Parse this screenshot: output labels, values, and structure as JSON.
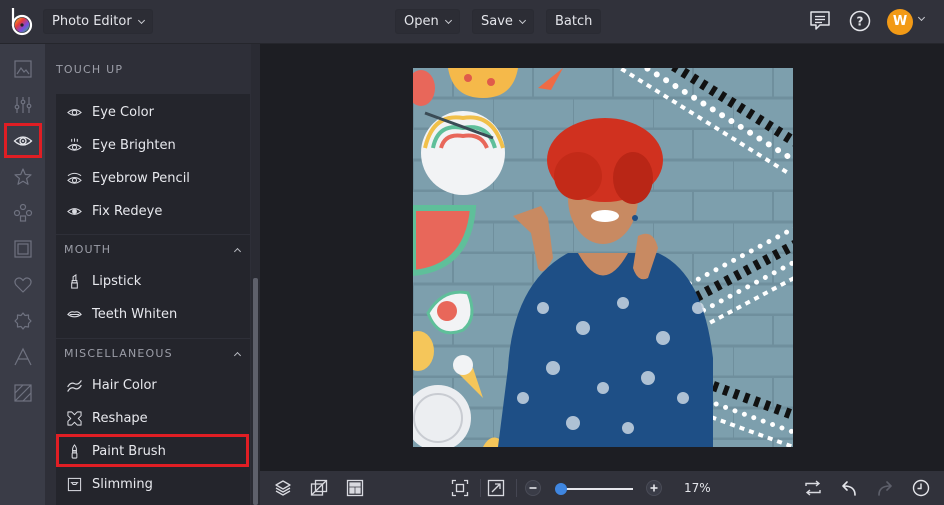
{
  "header": {
    "app_menu_label": "Photo Editor",
    "open_label": "Open",
    "save_label": "Save",
    "batch_label": "Batch",
    "icons": [
      "chat-icon",
      "help-icon"
    ],
    "avatar_initial": "W",
    "avatar_color": "#f29a16"
  },
  "rail": {
    "items": [
      {
        "name": "image-icon"
      },
      {
        "name": "adjust-sliders-icon"
      },
      {
        "name": "eye-icon",
        "active": true
      },
      {
        "name": "star-icon"
      },
      {
        "name": "graphics-icon"
      },
      {
        "name": "frame-icon"
      },
      {
        "name": "heart-icon"
      },
      {
        "name": "badge-icon"
      },
      {
        "name": "text-icon"
      },
      {
        "name": "texture-icon"
      }
    ]
  },
  "panel": {
    "section_title": "TOUCH UP",
    "eyes_items": [
      {
        "label": "Eye Color",
        "icon": "eye-icon"
      },
      {
        "label": "Eye Brighten",
        "icon": "eye-brighten-icon"
      },
      {
        "label": "Eyebrow Pencil",
        "icon": "eyebrow-icon"
      },
      {
        "label": "Fix Redeye",
        "icon": "redeye-icon"
      }
    ],
    "groups": [
      {
        "title": "MOUTH",
        "items": [
          {
            "label": "Lipstick",
            "icon": "lipstick-icon"
          },
          {
            "label": "Teeth Whiten",
            "icon": "lips-icon"
          }
        ]
      },
      {
        "title": "MISCELLANEOUS",
        "items": [
          {
            "label": "Hair Color",
            "icon": "hair-icon"
          },
          {
            "label": "Reshape",
            "icon": "reshape-icon"
          },
          {
            "label": "Paint Brush",
            "icon": "paint-brush-icon",
            "highlighted": true
          },
          {
            "label": "Slimming",
            "icon": "slimming-icon"
          }
        ]
      }
    ],
    "highlight_color": "#e01e24"
  },
  "canvas": {
    "image_alt": "Woman with red curly hair in blue floral dress against blue brick wall with food stickers"
  },
  "footer": {
    "zoom_percent": 17,
    "zoom_label": "17%",
    "zoom_fraction": 0.0,
    "left_icons": [
      "layers-icon",
      "crop-resize-icon",
      "layout-icon"
    ],
    "center_icons": [
      "fit-screen-icon",
      "expand-icon",
      "zoom-out-icon",
      "zoom-in-icon"
    ],
    "right_icons": [
      "flip-icon",
      "undo-icon",
      "redo-icon",
      "history-icon"
    ]
  }
}
